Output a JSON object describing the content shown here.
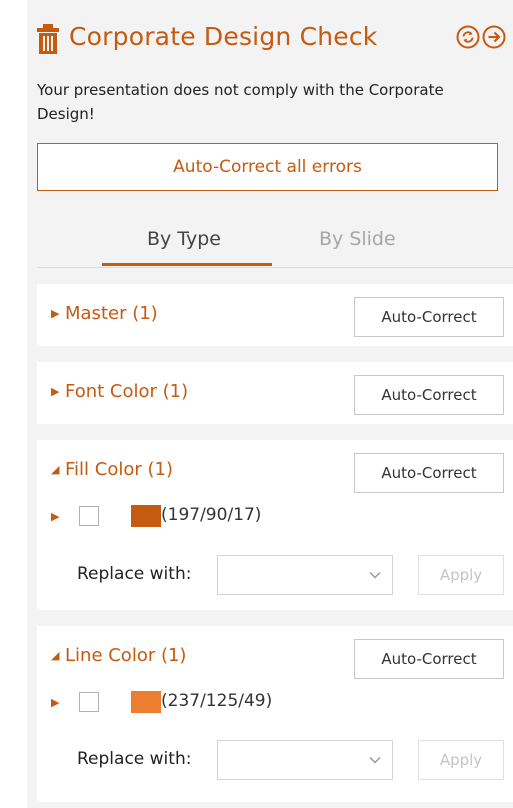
{
  "header": {
    "title": "Corporate Design Check",
    "icons": {
      "trash": "trash-icon",
      "refresh": "refresh-icon",
      "go": "arrow-right-circle-icon"
    }
  },
  "message": "Your presentation does not comply with the Corporate Design!",
  "autocorrect_all_label": "Auto-Correct all errors",
  "tabs": [
    {
      "label": "By Type",
      "active": true
    },
    {
      "label": "By Slide",
      "active": false
    }
  ],
  "sections": [
    {
      "title": "Master (1)",
      "expanded": false,
      "button": "Auto-Correct"
    },
    {
      "title": "Font Color (1)",
      "expanded": false,
      "button": "Auto-Correct"
    },
    {
      "title": "Fill Color (1)",
      "expanded": true,
      "button": "Auto-Correct",
      "item": {
        "rgb": "(197/90/17)",
        "swatch": "#c55a11"
      },
      "replace_label": "Replace with:",
      "select_value": "",
      "apply_label": "Apply"
    },
    {
      "title": "Line Color (1)",
      "expanded": true,
      "button": "Auto-Correct",
      "item": {
        "rgb": "(237/125/49)",
        "swatch": "#ed7d31"
      },
      "replace_label": "Replace with:",
      "select_value": "",
      "apply_label": "Apply"
    }
  ],
  "colors": {
    "accent": "#c55a11",
    "panel_bg": "#f3f3f3",
    "disabled_text": "#c4c4c4"
  }
}
